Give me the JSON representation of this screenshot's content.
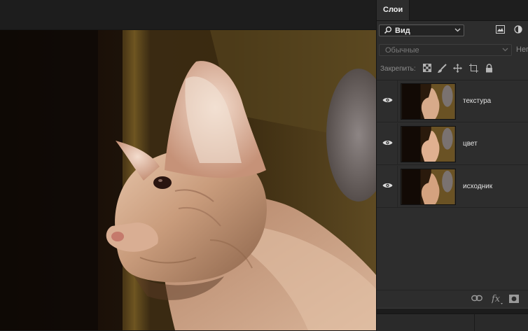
{
  "layers_panel": {
    "tab_title": "Слои",
    "filter": {
      "value": "Вид"
    },
    "blend_mode": {
      "value": "Обычные"
    },
    "opacity_label": "Непрозрачность",
    "lock_label": "Закрепить:",
    "layers": [
      {
        "name": "текстура",
        "visible": true
      },
      {
        "name": "цвет",
        "visible": true
      },
      {
        "name": "исходник",
        "visible": true
      }
    ],
    "bottom_icons": [
      "link-layers-icon",
      "fx-icon",
      "add-mask-icon"
    ]
  },
  "canvas": {
    "subject": "sphynx-cat-photo"
  },
  "colors": {
    "panel_bg": "#2d2d2d",
    "tab_bar_bg": "#1e1e1e",
    "canvas_bg": "#222222"
  }
}
